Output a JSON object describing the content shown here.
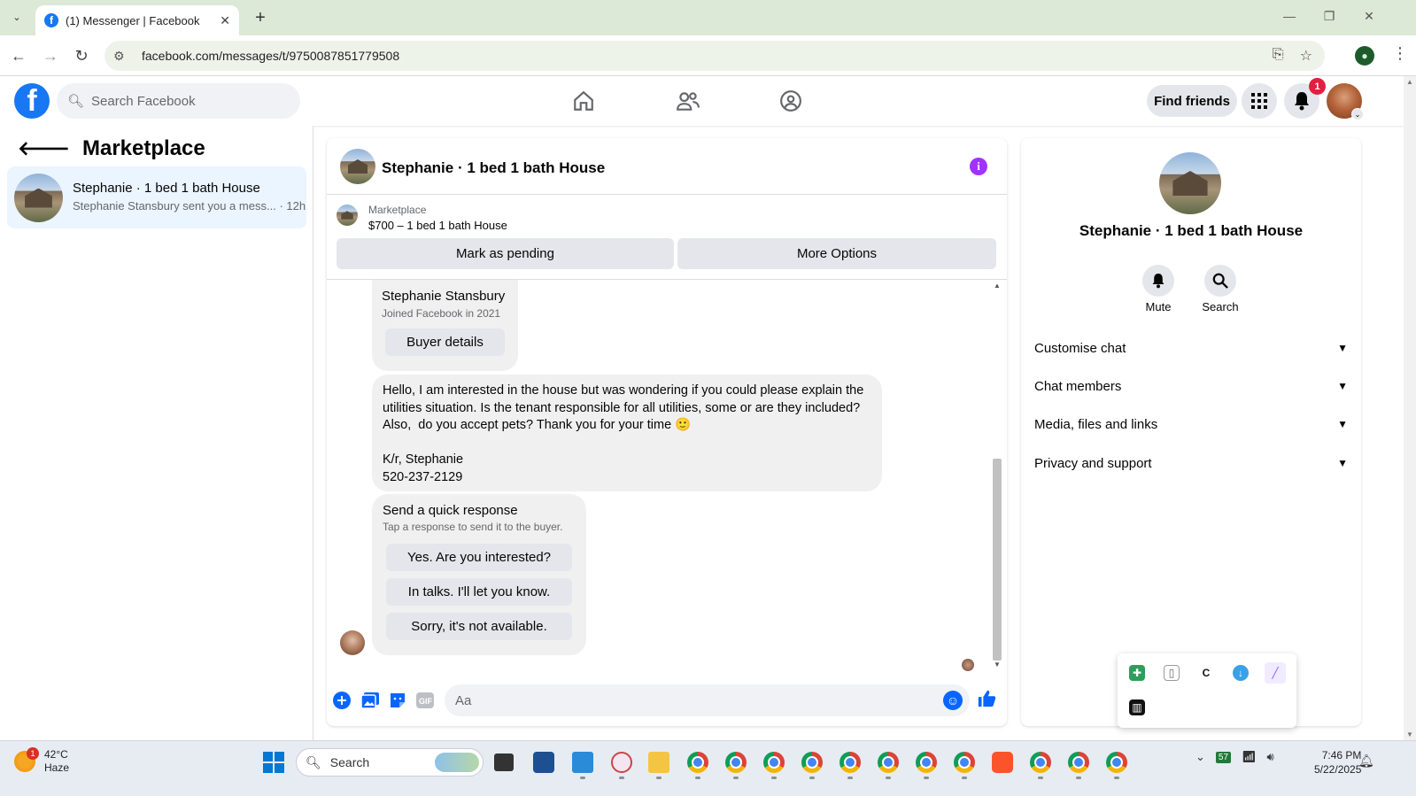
{
  "browser": {
    "tab_title": "(1) Messenger | Facebook",
    "url": "facebook.com/messages/t/9750087851779508",
    "tab_close": "✕",
    "new_tab": "+"
  },
  "fb": {
    "search_placeholder": "Search Facebook",
    "find_friends": "Find friends",
    "notifications_count": "1"
  },
  "left": {
    "title": "Marketplace",
    "conversation": {
      "name": "Stephanie · 1 bed 1 bath House",
      "snippet": "Stephanie Stansbury sent you a mess...",
      "time": "12h"
    }
  },
  "chat": {
    "title": "Stephanie · 1 bed 1 bath House",
    "listing_category": "Marketplace",
    "listing_price": "$700 – 1 bed 1 bath House",
    "mark_pending": "Mark as pending",
    "more_options": "More Options",
    "buyer_card": {
      "name": "Stephanie Stansbury",
      "joined": "Joined Facebook in 2021",
      "button": "Buyer details"
    },
    "message_lines": [
      "Hello, I am interested in the house but was wondering if you could please explain the",
      "utilities situation. Is the tenant responsible for all utilities, some or are they included?",
      "Also,  do you accept pets? Thank you for your time 🙂",
      "",
      "K/r, Stephanie",
      "520-237-2129"
    ],
    "quick": {
      "title": "Send a quick response",
      "subtitle": "Tap a response to send it to the buyer.",
      "options": [
        "Yes. Are you interested?",
        "In talks. I'll let you know.",
        "Sorry, it's not available."
      ]
    },
    "composer_placeholder": "Aa"
  },
  "right": {
    "name": "Stephanie · 1 bed 1 bath House",
    "mute": "Mute",
    "search": "Search",
    "sections": [
      "Customise chat",
      "Chat members",
      "Media, files and links",
      "Privacy and support"
    ]
  },
  "taskbar": {
    "temp": "42°C",
    "condition": "Haze",
    "weather_badge": "1",
    "search": "Search",
    "time": "7:46 PM",
    "date": "5/22/2025"
  }
}
